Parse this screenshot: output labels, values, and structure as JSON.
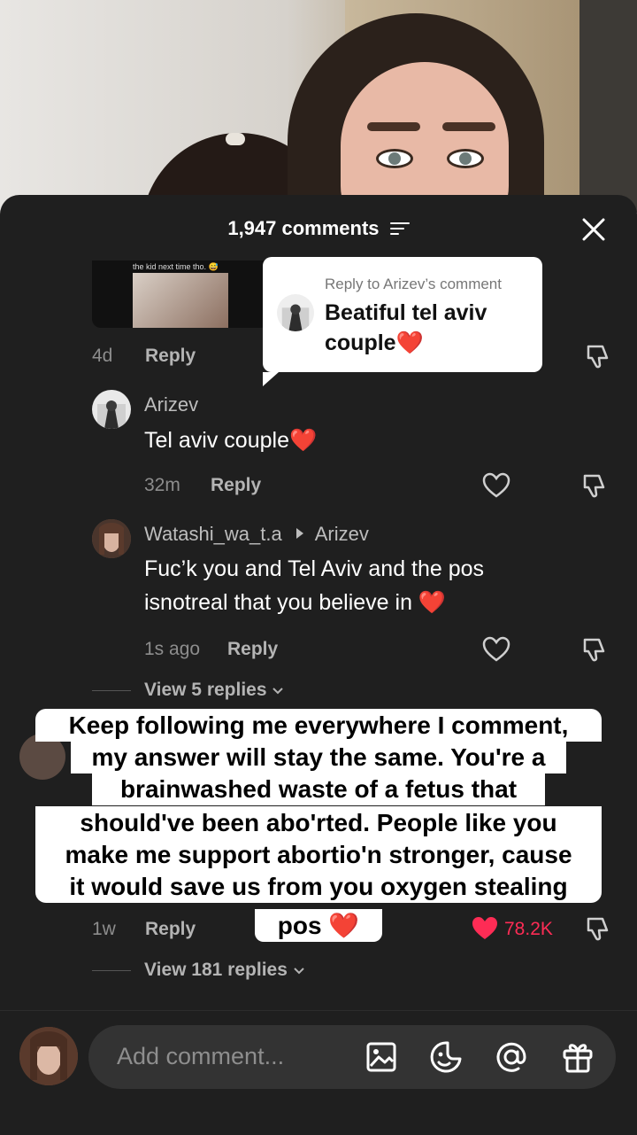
{
  "sheet": {
    "comment_count": "1,947 comments"
  },
  "thread": {
    "preview_caption": "the kid next time tho. 😅",
    "prev_comment_meta": {
      "time": "4d",
      "reply": "Reply"
    },
    "comment1": {
      "username": "Arizev",
      "text": "Tel aviv couple❤️",
      "time": "32m",
      "reply": "Reply"
    },
    "comment2": {
      "username": "Watashi_wa_t.a",
      "reply_to": "Arizev",
      "line1": "Fuc’k you and Tel Aviv and the pos",
      "line2": "isnotreal that you believe in ❤️",
      "time": "1s ago",
      "reply": "Reply"
    },
    "view_replies_1": "View 5 replies",
    "comment3_meta": {
      "time": "1w",
      "reply": "Reply",
      "likes": "78.2K"
    },
    "view_replies_2": "View 181 replies"
  },
  "reply_card": {
    "label": "Reply to Arizev’s comment",
    "text": "Beatiful tel aviv couple❤️"
  },
  "overlay_caption": [
    "Keep following me everywhere I comment,",
    "my answer will stay the same. You're a",
    "brainwashed waste of a fetus that",
    "should've been abo'rted. People like you",
    "make me support abortio'n stronger, cause",
    "it would save us from you oxygen stealing",
    "pos ❤️"
  ],
  "composer": {
    "placeholder": "Add comment..."
  },
  "colors": {
    "sheet_bg": "#1f1f1f",
    "like_red": "#fe2c55"
  },
  "icons": [
    "filter-icon",
    "close-icon",
    "heart-icon",
    "dislike-icon",
    "image-icon",
    "emoji-icon",
    "mention-icon",
    "gift-icon",
    "chevron-down-icon",
    "caret-right-icon"
  ]
}
